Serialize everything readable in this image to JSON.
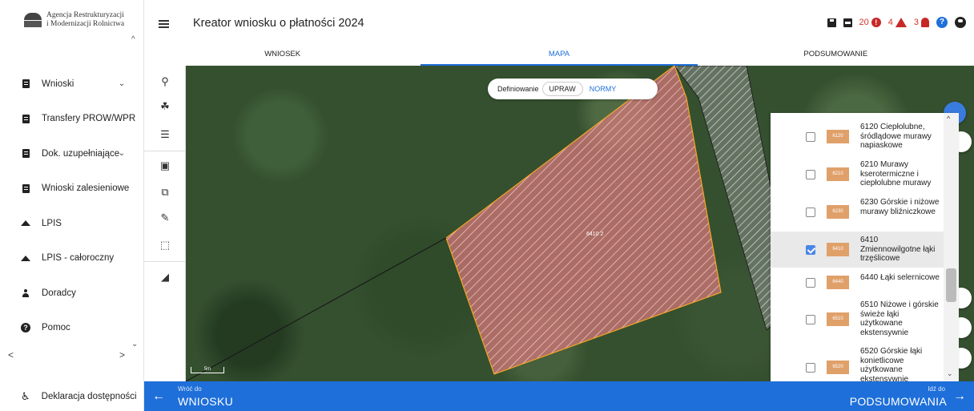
{
  "org": {
    "line1": "Agencja Restrukturyzacji",
    "line2": "i Modernizacji Rolnictwa"
  },
  "header": {
    "title": "Kreator wniosku o płatności 2024",
    "count_errors": "20",
    "count_warnings": "4",
    "count_notifications": "3"
  },
  "tabs": [
    {
      "label": "WNIOSEK"
    },
    {
      "label": "MAPA"
    },
    {
      "label": "PODSUMOWANIE"
    }
  ],
  "sidebar": {
    "items": [
      {
        "label": "Wnioski",
        "icon": "document-icon"
      },
      {
        "label": "Transfery PROW/WPR",
        "icon": "document-icon"
      },
      {
        "label": "Dok. uzupełniające",
        "icon": "document-icon"
      },
      {
        "label": "Wnioski zalesieniowe",
        "icon": "document-icon"
      },
      {
        "label": "LPIS",
        "icon": "mountain-icon"
      },
      {
        "label": "LPIS - całoroczny",
        "icon": "mountain-icon"
      },
      {
        "label": "Doradcy",
        "icon": "person-icon"
      },
      {
        "label": "Pomoc",
        "icon": "help-icon"
      }
    ],
    "accessibility": "Deklaracja dostępności"
  },
  "map": {
    "define_label": "Definiowanie",
    "opt_selected": "UPRAW",
    "opt_other": "NORMY",
    "scale": "5m",
    "parcel_code": "6410",
    "parcel_label": "6410 2",
    "parcel_color": "#d9797a"
  },
  "legend": [
    {
      "code": "6120",
      "text": "6120 Ciepłolubne, śródlądowe murawy napiaskowe",
      "checked": false
    },
    {
      "code": "6210",
      "text": "6210 Murawy kserotermiczne i ciepłolubne murawy",
      "checked": false
    },
    {
      "code": "6230",
      "text": "6230 Górskie i niżowe murawy bliźniczkowe",
      "checked": false
    },
    {
      "code": "6410",
      "text": "6410 Zmiennowilgotne łąki trzęślicowe",
      "checked": true
    },
    {
      "code": "6440",
      "text": "6440 Łąki selernicowe",
      "checked": false
    },
    {
      "code": "6510",
      "text": "6510 Niżowe i górskie świeże łąki użytkowane ekstensywnie",
      "checked": false
    },
    {
      "code": "6520",
      "text": "6520 Górskie łąki konietlicowe użytkowane ekstensywnie",
      "checked": false
    }
  ],
  "footer": {
    "back_small": "Wróć do",
    "back_big": "WNIOSKU",
    "next_small": "Idź do",
    "next_big": "PODSUMOWANIA"
  },
  "colors": {
    "accent": "#1e6fd9",
    "alert": "#c62828",
    "swatch": "#e0a06a"
  }
}
